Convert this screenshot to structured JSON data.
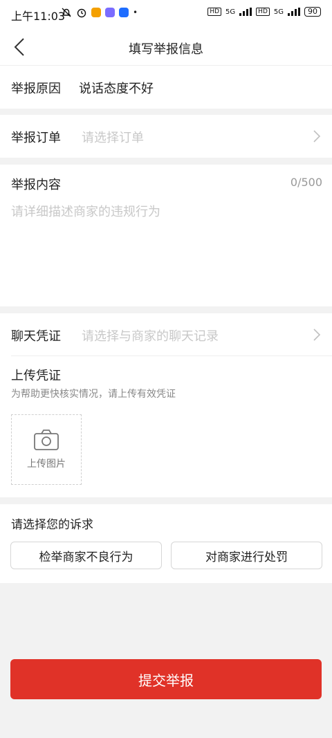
{
  "status_bar": {
    "time": "上午11:03",
    "signal_label_1": "5G",
    "signal_label_2": "5G",
    "battery": "90",
    "colors": {
      "app1": "#f4a000",
      "app2": "#7a6cff",
      "app3": "#1e6dff"
    }
  },
  "header": {
    "title": "填写举报信息"
  },
  "reason": {
    "label": "举报原因",
    "value": "说话态度不好"
  },
  "order": {
    "label": "举报订单",
    "placeholder": "请选择订单"
  },
  "content": {
    "label": "举报内容",
    "counter": "0/500",
    "placeholder": "请详细描述商家的违规行为"
  },
  "chat": {
    "label": "聊天凭证",
    "placeholder": "请选择与商家的聊天记录"
  },
  "upload": {
    "label": "上传凭证",
    "hint": "为帮助更快核实情况，请上传有效凭证",
    "button_label": "上传图片"
  },
  "appeal": {
    "label": "请选择您的诉求",
    "options": [
      "检举商家不良行为",
      "对商家进行处罚"
    ]
  },
  "submit": {
    "label": "提交举报",
    "color": "#e03228"
  }
}
